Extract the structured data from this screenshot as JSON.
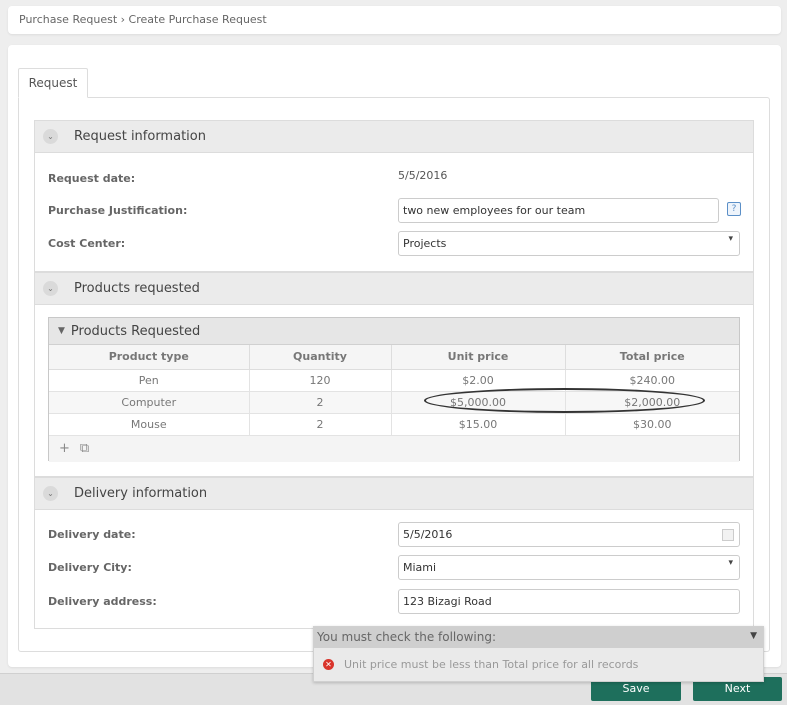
{
  "breadcrumb": {
    "parent": "Purchase Request",
    "separator": "›",
    "current": "Create Purchase Request"
  },
  "tabs": [
    {
      "label": "Request"
    }
  ],
  "sections": {
    "request_info": {
      "title": "Request information",
      "request_date_label": "Request date:",
      "request_date_value": "5/5/2016",
      "justification_label": "Purchase Justification:",
      "justification_value": "two new employees for our team",
      "cost_center_label": "Cost Center:",
      "cost_center_value": "Projects"
    },
    "products": {
      "title": "Products requested",
      "grid_title": "Products Requested",
      "columns": [
        "Product type",
        "Quantity",
        "Unit price",
        "Total price"
      ],
      "rows": [
        {
          "product": "Pen",
          "quantity": "120",
          "unit_price": "$2.00",
          "total_price": "$240.00"
        },
        {
          "product": "Computer",
          "quantity": "2",
          "unit_price": "$5,000.00",
          "total_price": "$2,000.00"
        },
        {
          "product": "Mouse",
          "quantity": "2",
          "unit_price": "$15.00",
          "total_price": "$30.00"
        }
      ],
      "add_icon": "+",
      "copy_icon": "⧉"
    },
    "delivery": {
      "title": "Delivery information",
      "date_label": "Delivery date:",
      "date_value": "5/5/2016",
      "city_label": "Delivery City:",
      "city_value": "Miami",
      "address_label": "Delivery address:",
      "address_value": "123 Bizagi Road"
    }
  },
  "validation": {
    "header": "You must check the following:",
    "message": "Unit price must be less than Total price for all records"
  },
  "buttons": {
    "save": "Save",
    "next": "Next"
  },
  "colors": {
    "primary_button": "#1e6f5c",
    "error": "#d9342b"
  }
}
